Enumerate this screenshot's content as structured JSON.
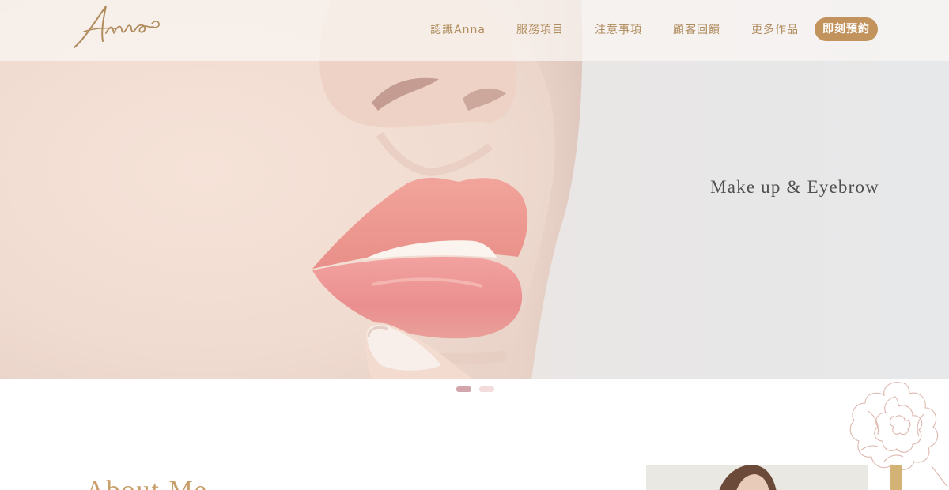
{
  "brand": {
    "logo_text": "Anna"
  },
  "nav": {
    "items": [
      {
        "label": "認識Anna"
      },
      {
        "label": "服務項目"
      },
      {
        "label": "注意事項"
      },
      {
        "label": "顧客回饋"
      },
      {
        "label": "更多作品"
      }
    ],
    "cta_label": "即刻預約"
  },
  "hero": {
    "tagline": "Make up & Eyebrow",
    "slide_count": 2,
    "active_slide": 1
  },
  "about": {
    "title": "About Me"
  },
  "colors": {
    "accent_gold": "#c2935c",
    "nav_text": "#b08b5c",
    "dot_active": "#d3a5ad",
    "dot_inactive": "#f4dcdd",
    "title_gold": "#c89f6a"
  },
  "icons": [
    "anna-logo-icon",
    "flower-line-art-icon"
  ]
}
